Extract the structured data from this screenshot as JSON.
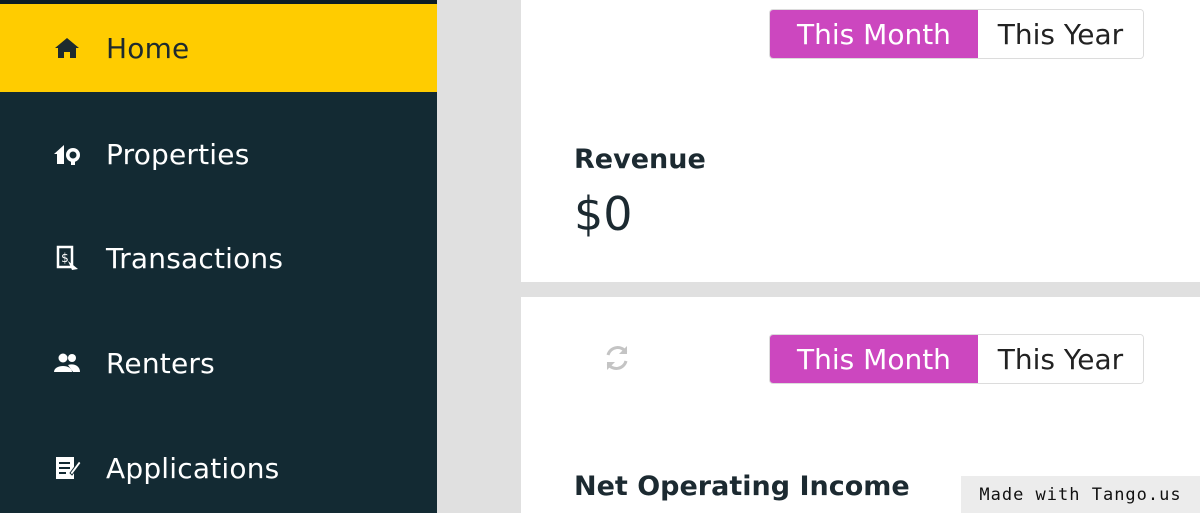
{
  "sidebar": {
    "items": [
      {
        "label": "Home",
        "icon": "home-icon",
        "active": true
      },
      {
        "label": "Properties",
        "icon": "properties-icon",
        "active": false
      },
      {
        "label": "Transactions",
        "icon": "transactions-icon",
        "active": false
      },
      {
        "label": "Renters",
        "icon": "renters-icon",
        "active": false
      },
      {
        "label": "Applications",
        "icon": "applications-icon",
        "active": false
      }
    ]
  },
  "revenue_card": {
    "toggle": {
      "this_month": "This Month",
      "this_year": "This Year",
      "selected": "This Month"
    },
    "label": "Revenue",
    "value": "$0"
  },
  "noi_card": {
    "toggle": {
      "this_month": "This Month",
      "this_year": "This Year",
      "selected": "This Month"
    },
    "label": "Net Operating Income",
    "refresh_icon": "refresh-icon"
  },
  "watermark": "Made with Tango.us",
  "colors": {
    "sidebar_bg": "#132a33",
    "active_nav": "#ffcc00",
    "toggle_active": "#cc47bf"
  }
}
